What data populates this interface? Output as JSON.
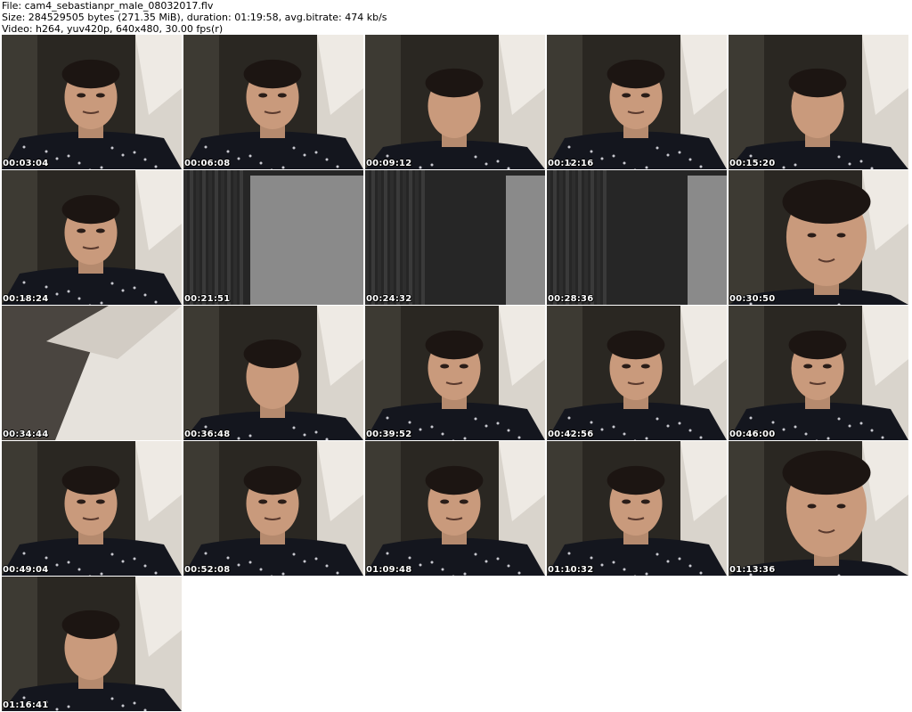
{
  "header": {
    "file_line": "File: cam4_sebastianpr_male_08032017.flv",
    "size_line": "Size: 284529505 bytes (271.35 MiB), duration: 01:19:58, avg.bitrate: 474 kb/s",
    "video_line": "Video: h264, yuv420p, 640x480, 30.00 fps(r)"
  },
  "thumbnails": [
    {
      "timestamp": "00:03:04",
      "kind": "face"
    },
    {
      "timestamp": "00:06:08",
      "kind": "face"
    },
    {
      "timestamp": "00:09:12",
      "kind": "face-down"
    },
    {
      "timestamp": "00:12:16",
      "kind": "face"
    },
    {
      "timestamp": "00:15:20",
      "kind": "face-down"
    },
    {
      "timestamp": "00:18:24",
      "kind": "face"
    },
    {
      "timestamp": "00:21:51",
      "kind": "blank"
    },
    {
      "timestamp": "00:24:32",
      "kind": "blank"
    },
    {
      "timestamp": "00:28:36",
      "kind": "blank"
    },
    {
      "timestamp": "00:30:50",
      "kind": "closeup"
    },
    {
      "timestamp": "00:34:44",
      "kind": "wall"
    },
    {
      "timestamp": "00:36:48",
      "kind": "face-down"
    },
    {
      "timestamp": "00:39:52",
      "kind": "face"
    },
    {
      "timestamp": "00:42:56",
      "kind": "face"
    },
    {
      "timestamp": "00:46:00",
      "kind": "face"
    },
    {
      "timestamp": "00:49:04",
      "kind": "face"
    },
    {
      "timestamp": "00:52:08",
      "kind": "face"
    },
    {
      "timestamp": "01:09:48",
      "kind": "face"
    },
    {
      "timestamp": "01:10:32",
      "kind": "face"
    },
    {
      "timestamp": "01:13:36",
      "kind": "closeup"
    },
    {
      "timestamp": "01:16:41",
      "kind": "face-down"
    }
  ]
}
